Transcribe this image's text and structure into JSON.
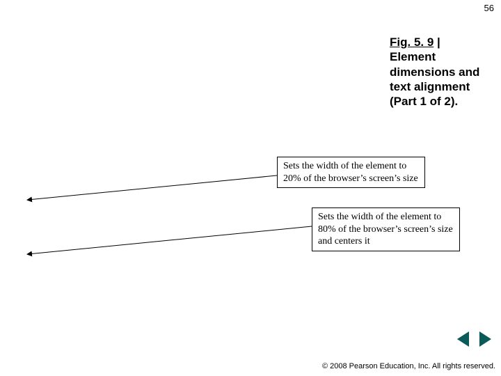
{
  "page_number": "56",
  "title": {
    "fig_label": "Fig. 5. 9",
    "separator": " | ",
    "caption": "Element dimensions and text alignment (Part 1 of 2)."
  },
  "callouts": [
    "Sets the width of the element to 20% of the browser’s screen’s size",
    "Sets the width of the element to 80% of the browser’s screen’s size and centers it"
  ],
  "nav": {
    "prev_icon": "triangle-left",
    "next_icon": "triangle-right",
    "accent_color": "#319b9b"
  },
  "copyright": "© 2008 Pearson Education, Inc. All rights reserved."
}
